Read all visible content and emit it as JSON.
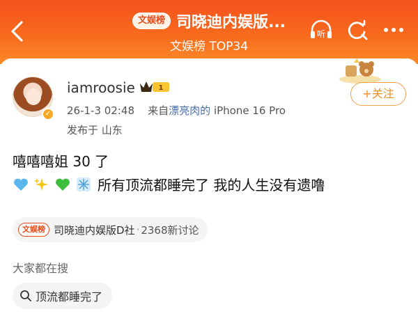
{
  "header": {
    "brand_badge": "文娱榜",
    "title": "司晓迪内娱版...",
    "subtitle": "文娱榜 TOP34",
    "icons": [
      "back-arrow-icon",
      "headphone-listen-icon",
      "refresh-search-icon",
      "more-icon"
    ],
    "listen_label": "听"
  },
  "post": {
    "username": "iamroosie",
    "vip_level": "1",
    "time": "26-1-3 02:48",
    "source_prefix": "来自",
    "source_link": "漂亮肉的",
    "source_device": " iPhone 16 Pro",
    "location": "发布于 山东",
    "follow_label": "+关注",
    "line1": "嘻嘻嘻姐 30 了",
    "line2_emojis": [
      "blue-heart-icon",
      "sparkles-icon",
      "green-heart-icon",
      "snowflake-icon"
    ],
    "line2_text": "所有顶流都睡完了 我的人生没有遗噜"
  },
  "topic": {
    "logo": "文娱榜",
    "name": "司晓迪内娱版D社",
    "separator": "·",
    "count": "2368新讨论"
  },
  "related": {
    "section_title": "大家都在搜",
    "search_term": "顶流都睡完了"
  },
  "colors": {
    "header_gradient_top": "#f4511e",
    "header_gradient_bottom": "#fb8a2a",
    "follow_accent": "#f28c1f",
    "link_blue": "#4a6ea9"
  }
}
